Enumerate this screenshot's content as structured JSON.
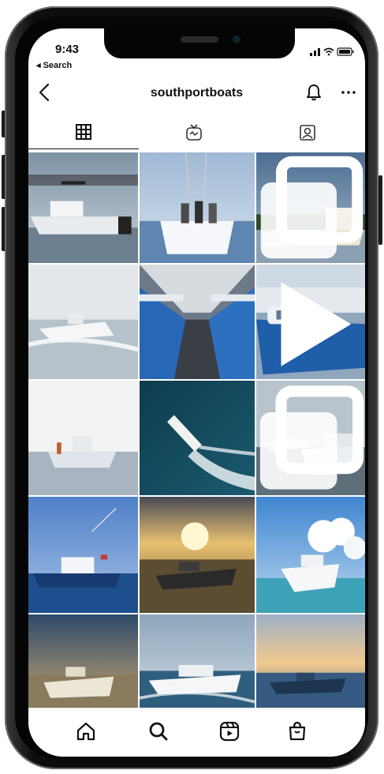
{
  "status_bar": {
    "time": "9:43",
    "back_app": "◂ Search"
  },
  "profile": {
    "username": "southportboats"
  },
  "tabs": [
    {
      "name": "grid",
      "icon": "grid-icon",
      "active": true
    },
    {
      "name": "igtv",
      "icon": "igtv-icon",
      "active": false
    },
    {
      "name": "tagged",
      "icon": "tagged-icon",
      "active": false
    }
  ],
  "posts": [
    {
      "scene": "boat-at-dock",
      "badge": null
    },
    {
      "scene": "people-on-boat-bow",
      "badge": null
    },
    {
      "scene": "boat-on-shore",
      "badge": "multiple-posts-icon"
    },
    {
      "scene": "boat-wake-haze",
      "badge": null
    },
    {
      "scene": "boats-in-factory",
      "badge": null
    },
    {
      "scene": "blue-boat-marina",
      "badge": "reel-play-icon"
    },
    {
      "scene": "boat-haze-white",
      "badge": null
    },
    {
      "scene": "aerial-boat-wake",
      "badge": null
    },
    {
      "scene": "spray-boat",
      "badge": "multiple-posts-icon"
    },
    {
      "scene": "blue-boat-flag",
      "badge": null
    },
    {
      "scene": "sunset-boat",
      "badge": null
    },
    {
      "scene": "boat-clouds",
      "badge": null
    },
    {
      "scene": "boat-dusk-run",
      "badge": null
    },
    {
      "scene": "cruiser-run",
      "badge": null
    },
    {
      "scene": "boat-sunset-cruise",
      "badge": null
    }
  ],
  "bottom_nav": [
    "home-icon",
    "search-icon",
    "reels-icon",
    "shop-icon"
  ]
}
